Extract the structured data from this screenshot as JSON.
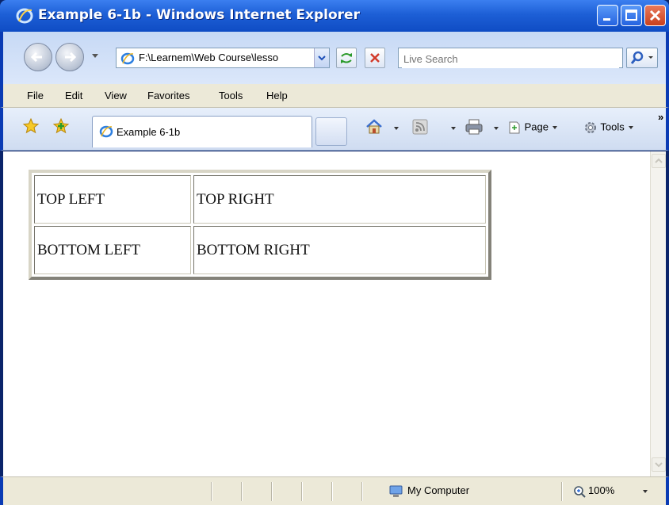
{
  "window": {
    "title": "Example 6-1b - Windows Internet Explorer"
  },
  "address": {
    "url": "F:\\Learnem\\Web Course\\lesso"
  },
  "search": {
    "placeholder": "Live Search"
  },
  "menu": [
    "File",
    "Edit",
    "View",
    "Favorites",
    "Tools",
    "Help"
  ],
  "tab": {
    "label": "Example 6-1b"
  },
  "commands": {
    "page_label": "Page",
    "tools_label": "Tools",
    "chevron": "»"
  },
  "table": [
    [
      "TOP LEFT",
      "TOP RIGHT"
    ],
    [
      "BOTTOM LEFT",
      "BOTTOM RIGHT"
    ]
  ],
  "status": {
    "zone": "My Computer",
    "zoom": "100%"
  },
  "colors": {
    "titlebar": "#1d5fd6",
    "frame": "#0a3bb4",
    "chrome": "#ece9d8"
  },
  "icons": [
    "ie-logo-icon",
    "minimize-icon",
    "maximize-icon",
    "close-icon",
    "back-icon",
    "forward-icon",
    "refresh-icon",
    "stop-icon",
    "search-icon",
    "favorites-star-icon",
    "add-favorites-icon",
    "home-icon",
    "feeds-icon",
    "print-icon",
    "page-icon",
    "tools-gear-icon",
    "computer-icon",
    "zoom-icon"
  ]
}
